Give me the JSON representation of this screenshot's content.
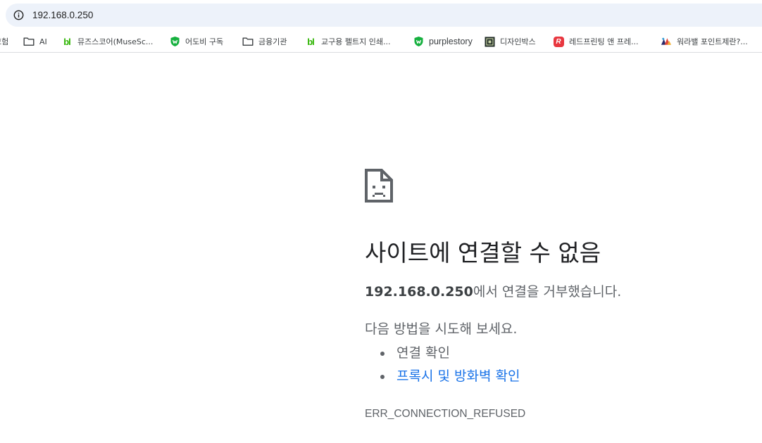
{
  "address_bar": {
    "url": "192.168.0.250",
    "icon": "info-icon"
  },
  "bookmarks": [
    {
      "label": "모험",
      "icon": "none"
    },
    {
      "label": "AI",
      "icon": "folder-icon"
    },
    {
      "label": "뮤즈스코어(MuseSc...",
      "icon": "blog-icon"
    },
    {
      "label": "어도비 구독",
      "icon": "shield-icon"
    },
    {
      "label": "금융기관",
      "icon": "folder-icon"
    },
    {
      "label": "교구용 펠트지 인쇄...",
      "icon": "blog-icon"
    },
    {
      "label": "purplestory",
      "icon": "shield-icon"
    },
    {
      "label": "디자인박스",
      "icon": "designbox-icon"
    },
    {
      "label": "레드프린팅 앤 프레...",
      "icon": "redprinting-icon"
    },
    {
      "label": "워라밸 포인트제란?...",
      "icon": "worklife-icon"
    }
  ],
  "error": {
    "icon": "sad-page-icon",
    "title": "사이트에 연결할 수 없음",
    "host": "192.168.0.250",
    "description_suffix": "에서 연결을 거부했습니다.",
    "suggestions_heading": "다음 방법을 시도해 보세요.",
    "suggestions": [
      {
        "label": "연결 확인",
        "is_link": false
      },
      {
        "label": "프록시 및 방화벽 확인",
        "is_link": true
      }
    ],
    "code": "ERR_CONNECTION_REFUSED"
  },
  "colors": {
    "omnibox_bg": "#edf2fa",
    "link": "#1a73e8",
    "text_secondary": "#5f6368",
    "bl_green": "#2db400",
    "shield_green": "#15b03e",
    "redprinting": "#e8373f"
  }
}
